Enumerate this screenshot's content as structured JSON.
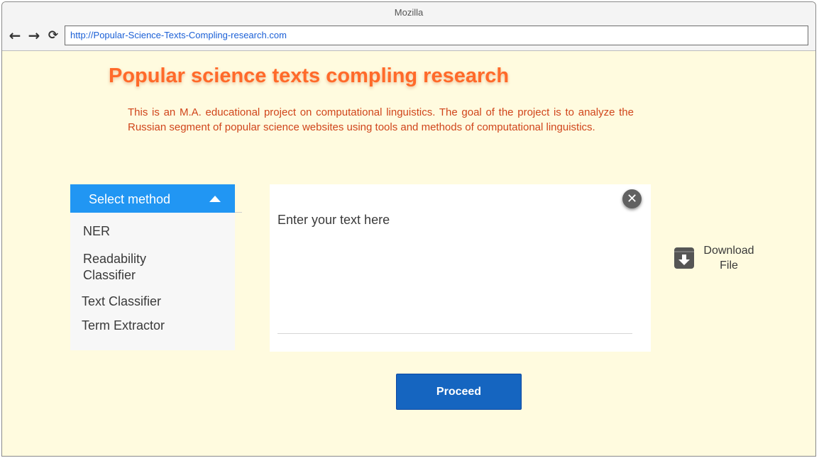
{
  "browser": {
    "window_title": "Mozilla",
    "url": "http://Popular-Science-Texts-Compling-research.com",
    "back_icon": "arrow-left-icon",
    "forward_icon": "arrow-right-icon",
    "reload_icon": "reload-icon"
  },
  "page": {
    "title": "Popular science texts compling research",
    "description": "This is an M.A. educational project on computational linguistics. The  goal of the project is to analyze the Russian segment of popular science  websites using tools and methods of computational linguistics."
  },
  "method_select": {
    "header_label": "Select method",
    "state": "expanded",
    "options": [
      {
        "label": "NER"
      },
      {
        "label": "Readability Classifier"
      },
      {
        "label": "Text Classifier"
      },
      {
        "label": "Term Extractor"
      }
    ]
  },
  "text_area": {
    "placeholder": "Enter your text here",
    "value": "",
    "clear_icon": "close-icon"
  },
  "download": {
    "label": "Download File",
    "icon": "archive-download-icon"
  },
  "actions": {
    "proceed_label": "Proceed"
  },
  "colors": {
    "page_background": "#fffbdf",
    "title": "#ff6a2a",
    "description": "#d0451b",
    "select_header": "#2196f3",
    "proceed_button": "#1565c0"
  }
}
